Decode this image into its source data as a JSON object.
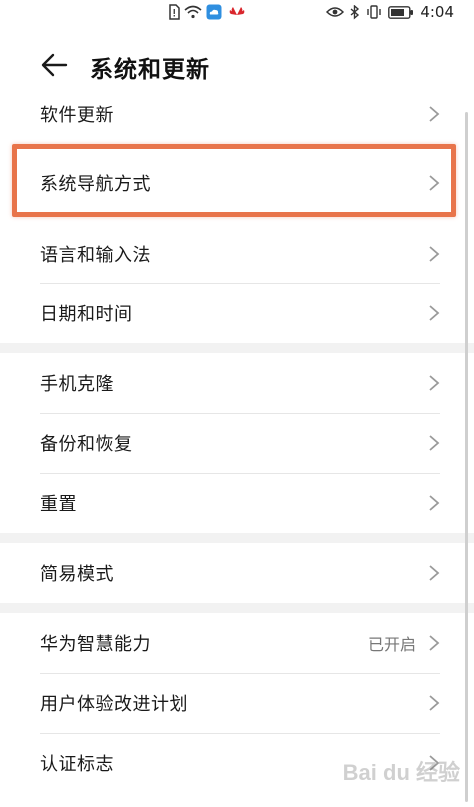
{
  "status_bar": {
    "time": "4:04",
    "icons_center": [
      "sim-alert-icon",
      "wifi-icon",
      "cloud-icon",
      "huawei-logo-icon"
    ],
    "icons_right": [
      "eye-icon",
      "bluetooth-icon",
      "vibrate-icon",
      "battery-icon"
    ]
  },
  "header": {
    "title": "系统和更新",
    "back_icon": "arrow-left-icon"
  },
  "sections": [
    {
      "items": [
        {
          "label": "软件更新"
        },
        {
          "label": "系统导航方式",
          "highlighted": true
        },
        {
          "label": "语言和输入法"
        },
        {
          "label": "日期和时间"
        }
      ]
    },
    {
      "items": [
        {
          "label": "手机克隆"
        },
        {
          "label": "备份和恢复"
        },
        {
          "label": "重置"
        }
      ]
    },
    {
      "items": [
        {
          "label": "简易模式"
        }
      ]
    },
    {
      "items": [
        {
          "label": "华为智慧能力",
          "value": "已开启"
        },
        {
          "label": "用户体验改进计划"
        },
        {
          "label": "认证标志"
        }
      ]
    }
  ],
  "watermark": "Bai du 经验",
  "colors": {
    "highlight": "#e8744a",
    "section_gap": "#f2f2f2",
    "divider": "#e6e6e6"
  }
}
